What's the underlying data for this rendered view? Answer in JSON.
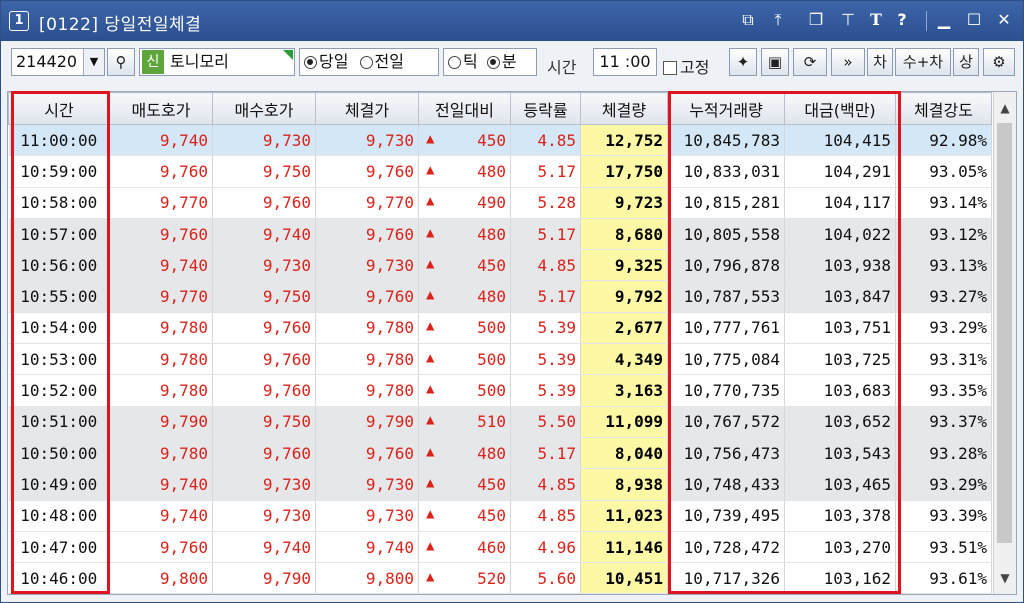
{
  "window": {
    "number": "1",
    "title": "[0122] 당일전일체결",
    "title_icons": [
      "restore-icon",
      "pin-top-icon",
      "copy-window-icon",
      "pin-icon",
      "font-size-icon",
      "help-icon",
      "minimize-icon",
      "maximize-icon",
      "close-icon"
    ]
  },
  "toolbar": {
    "stock_code": "214420",
    "badge": "신",
    "stock_name": "토니모리",
    "radio_day": [
      {
        "label": "당일",
        "selected": true
      },
      {
        "label": "전일",
        "selected": false
      }
    ],
    "radio_unit": [
      {
        "label": "틱",
        "selected": false
      },
      {
        "label": "분",
        "selected": true
      }
    ],
    "time_label": "시간",
    "time_value": "11 :00",
    "fixed_label": "고정",
    "btn_cha": "차",
    "btn_sucha": "수+차",
    "btn_sang": "상"
  },
  "table": {
    "headers": [
      "시간",
      "매도호가",
      "매수호가",
      "체결가",
      "전일대비",
      "등락률",
      "체결량",
      "누적거래량",
      "대금(백만)",
      "체결강도"
    ],
    "rows": [
      [
        "11:00:00",
        "9,740",
        "9,730",
        "9,730",
        "450",
        "4.85",
        "12,752",
        "10,845,783",
        "104,415",
        "92.98%"
      ],
      [
        "10:59:00",
        "9,760",
        "9,750",
        "9,760",
        "480",
        "5.17",
        "17,750",
        "10,833,031",
        "104,291",
        "93.05%"
      ],
      [
        "10:58:00",
        "9,770",
        "9,760",
        "9,770",
        "490",
        "5.28",
        "9,723",
        "10,815,281",
        "104,117",
        "93.14%"
      ],
      [
        "10:57:00",
        "9,760",
        "9,740",
        "9,760",
        "480",
        "5.17",
        "8,680",
        "10,805,558",
        "104,022",
        "93.12%"
      ],
      [
        "10:56:00",
        "9,740",
        "9,730",
        "9,730",
        "450",
        "4.85",
        "9,325",
        "10,796,878",
        "103,938",
        "93.13%"
      ],
      [
        "10:55:00",
        "9,770",
        "9,750",
        "9,760",
        "480",
        "5.17",
        "9,792",
        "10,787,553",
        "103,847",
        "93.27%"
      ],
      [
        "10:54:00",
        "9,780",
        "9,760",
        "9,780",
        "500",
        "5.39",
        "2,677",
        "10,777,761",
        "103,751",
        "93.29%"
      ],
      [
        "10:53:00",
        "9,780",
        "9,760",
        "9,780",
        "500",
        "5.39",
        "4,349",
        "10,775,084",
        "103,725",
        "93.31%"
      ],
      [
        "10:52:00",
        "9,780",
        "9,760",
        "9,780",
        "500",
        "5.39",
        "3,163",
        "10,770,735",
        "103,683",
        "93.35%"
      ],
      [
        "10:51:00",
        "9,790",
        "9,750",
        "9,790",
        "510",
        "5.50",
        "11,099",
        "10,767,572",
        "103,652",
        "93.37%"
      ],
      [
        "10:50:00",
        "9,780",
        "9,760",
        "9,760",
        "480",
        "5.17",
        "8,040",
        "10,756,473",
        "103,543",
        "93.28%"
      ],
      [
        "10:49:00",
        "9,740",
        "9,730",
        "9,730",
        "450",
        "4.85",
        "8,938",
        "10,748,433",
        "103,465",
        "93.29%"
      ],
      [
        "10:48:00",
        "9,740",
        "9,730",
        "9,730",
        "450",
        "4.85",
        "11,023",
        "10,739,495",
        "103,378",
        "93.39%"
      ],
      [
        "10:47:00",
        "9,760",
        "9,740",
        "9,740",
        "460",
        "4.96",
        "11,146",
        "10,728,472",
        "103,270",
        "93.51%"
      ],
      [
        "10:46:00",
        "9,800",
        "9,790",
        "9,800",
        "520",
        "5.60",
        "10,451",
        "10,717,326",
        "103,162",
        "93.61%"
      ]
    ],
    "up_marker": "▲",
    "price_color": "#d9231c",
    "volume_highlight": "#fcf8a6"
  }
}
